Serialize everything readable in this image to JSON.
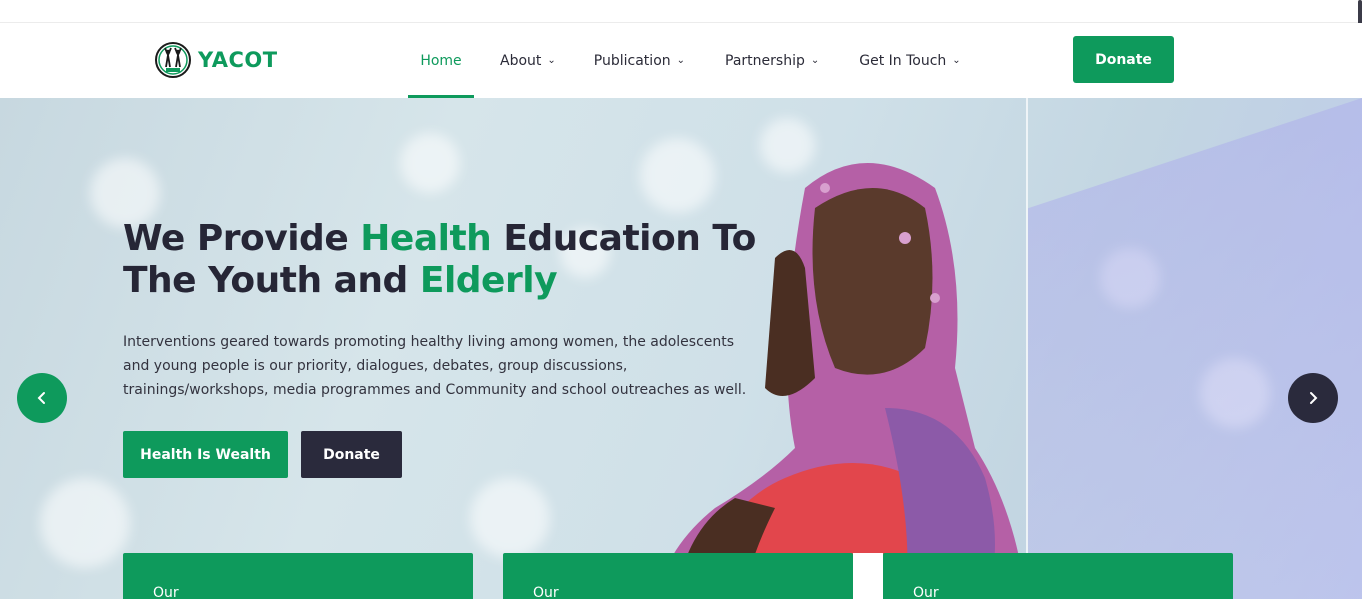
{
  "brand": {
    "name": "YACOT",
    "icon": "yacot-logo-icon",
    "accent_color": "#0e9a5c",
    "dark_color": "#2a2a3c"
  },
  "nav": {
    "items": [
      {
        "label": "Home",
        "active": true
      },
      {
        "label": "About",
        "dropdown": true
      },
      {
        "label": "Publication",
        "dropdown": true
      },
      {
        "label": "Partnership",
        "dropdown": true
      },
      {
        "label": "Get In Touch",
        "dropdown": true
      }
    ],
    "donate_label": "Donate"
  },
  "hero": {
    "headline_part1": "We Provide ",
    "headline_highlight1": "Health",
    "headline_part2": " Education To The Youth and ",
    "headline_highlight2": "Elderly",
    "description": "Interventions geared towards promoting healthy living among women, the adolescents and young people is our priority, dialogues, debates, group discussions, trainings/workshops, media programmes and Community and school outreaches as well.",
    "primary_button": "Health Is Wealth",
    "secondary_button": "Donate",
    "prev_icon": "chevron-left-icon",
    "next_icon": "chevron-right-icon"
  },
  "cards": [
    {
      "label": "Our"
    },
    {
      "label": "Our"
    },
    {
      "label": "Our"
    }
  ]
}
